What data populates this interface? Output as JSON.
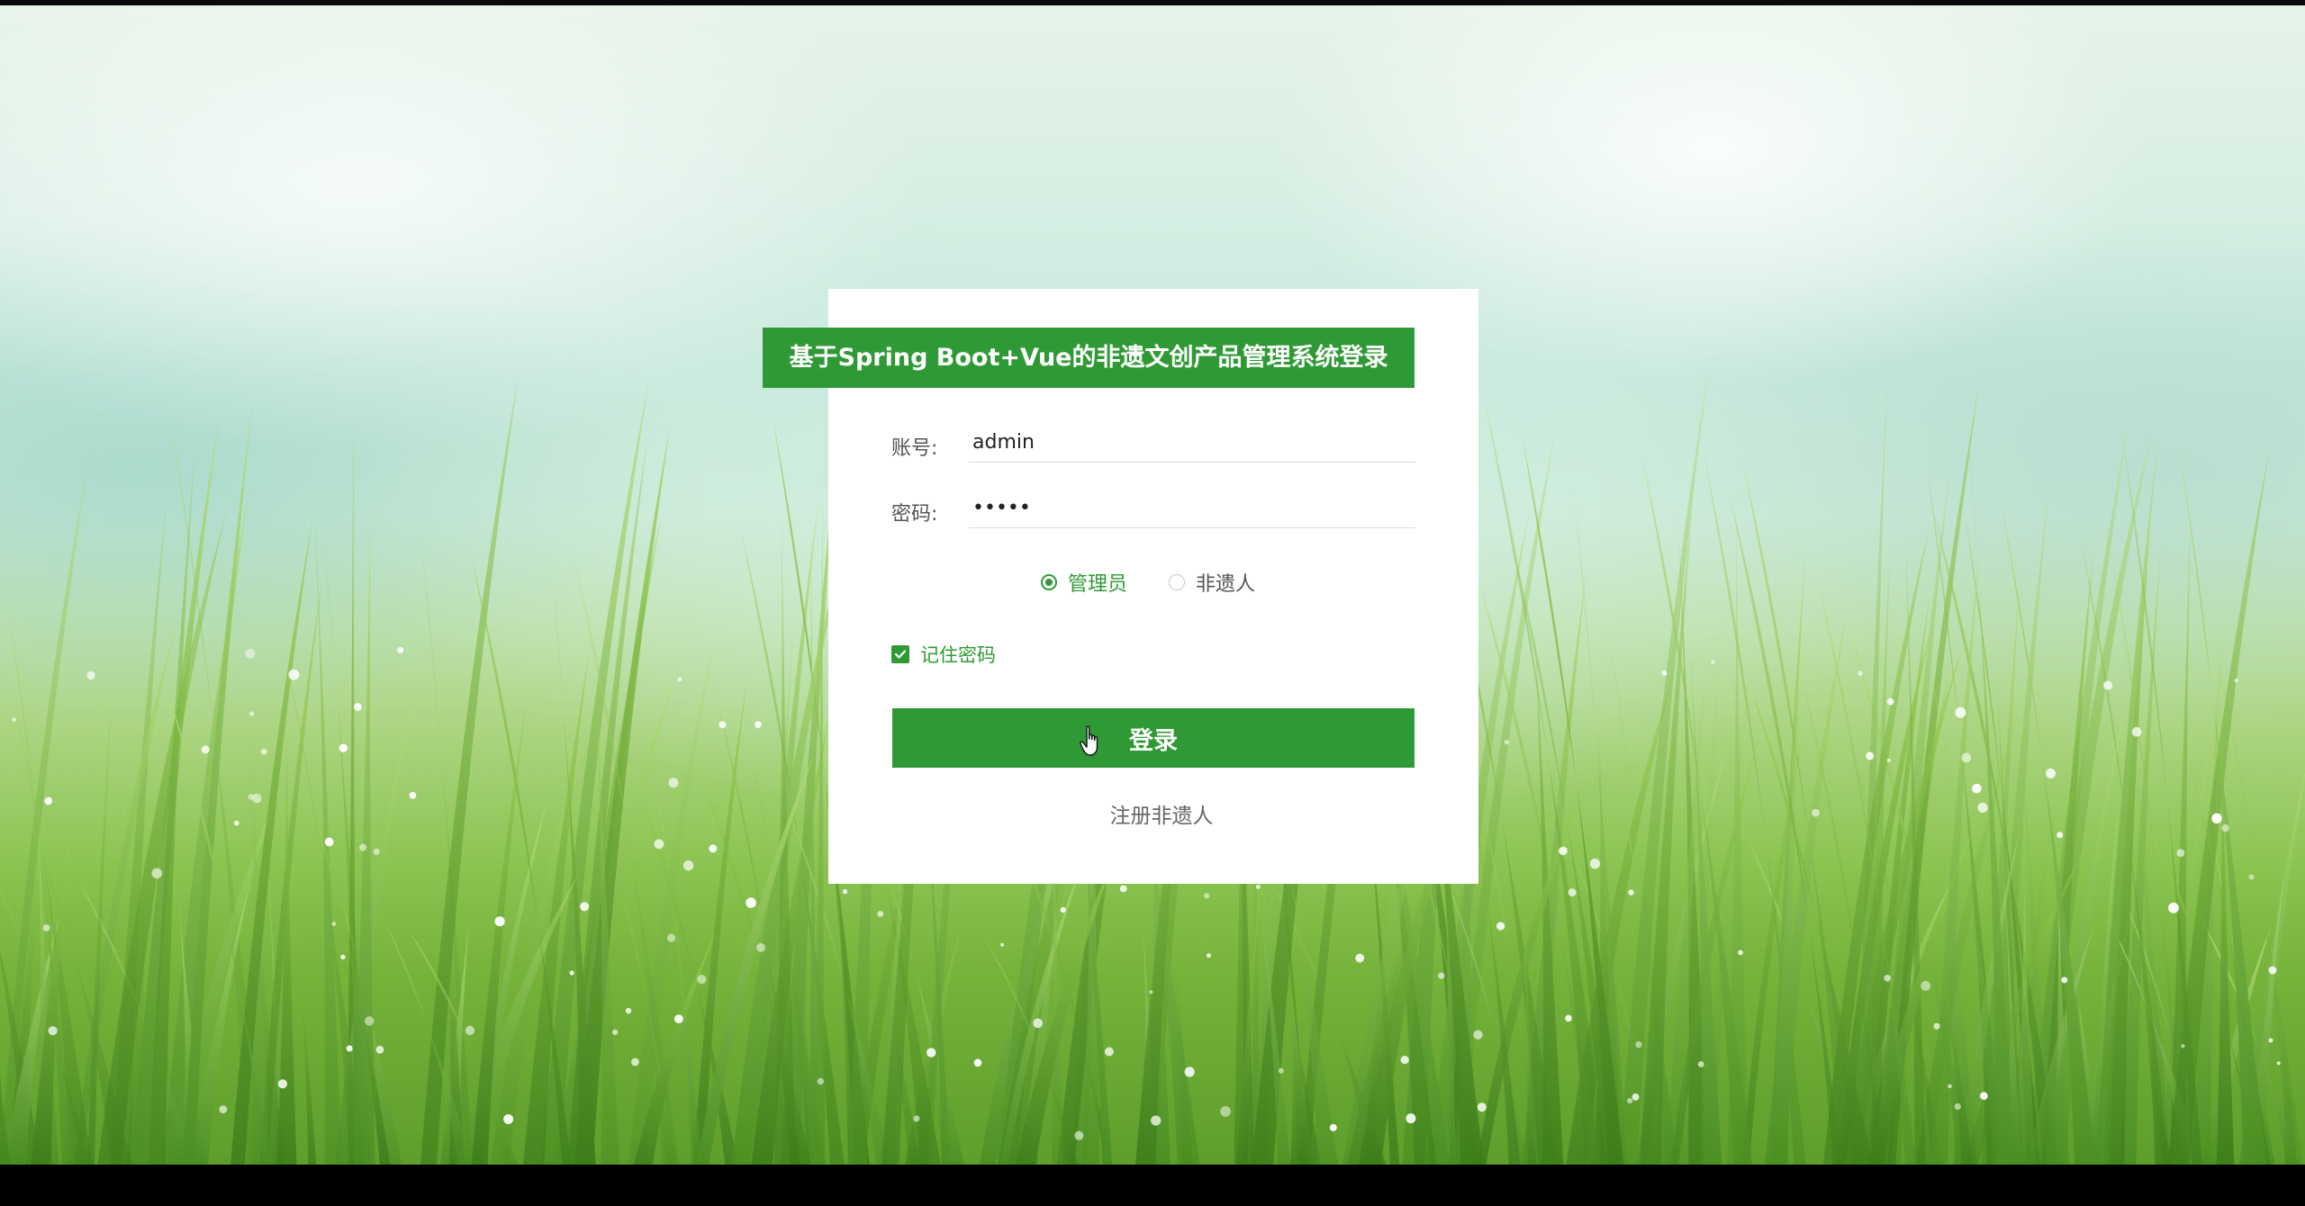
{
  "login": {
    "title": "基于Spring Boot+Vue的非遗文创产品管理系统登录",
    "account_label": "账号:",
    "account_value": "admin",
    "password_label": "密码:",
    "password_value": "•••••",
    "roles": [
      {
        "label": "管理员",
        "selected": true
      },
      {
        "label": "非遗人",
        "selected": false
      }
    ],
    "remember_label": "记住密码",
    "remember_checked": true,
    "submit_label": "登录",
    "register_label": "注册非遗人"
  },
  "colors": {
    "accent": "#2f9a35",
    "card": "#ffffff",
    "label": "#555555"
  },
  "icons": {
    "radio_selected": "radio-checked-icon",
    "radio_unselected": "radio-unchecked-icon",
    "checkbox": "checkbox-checked-icon",
    "cursor": "hand-pointer-cursor-icon"
  }
}
